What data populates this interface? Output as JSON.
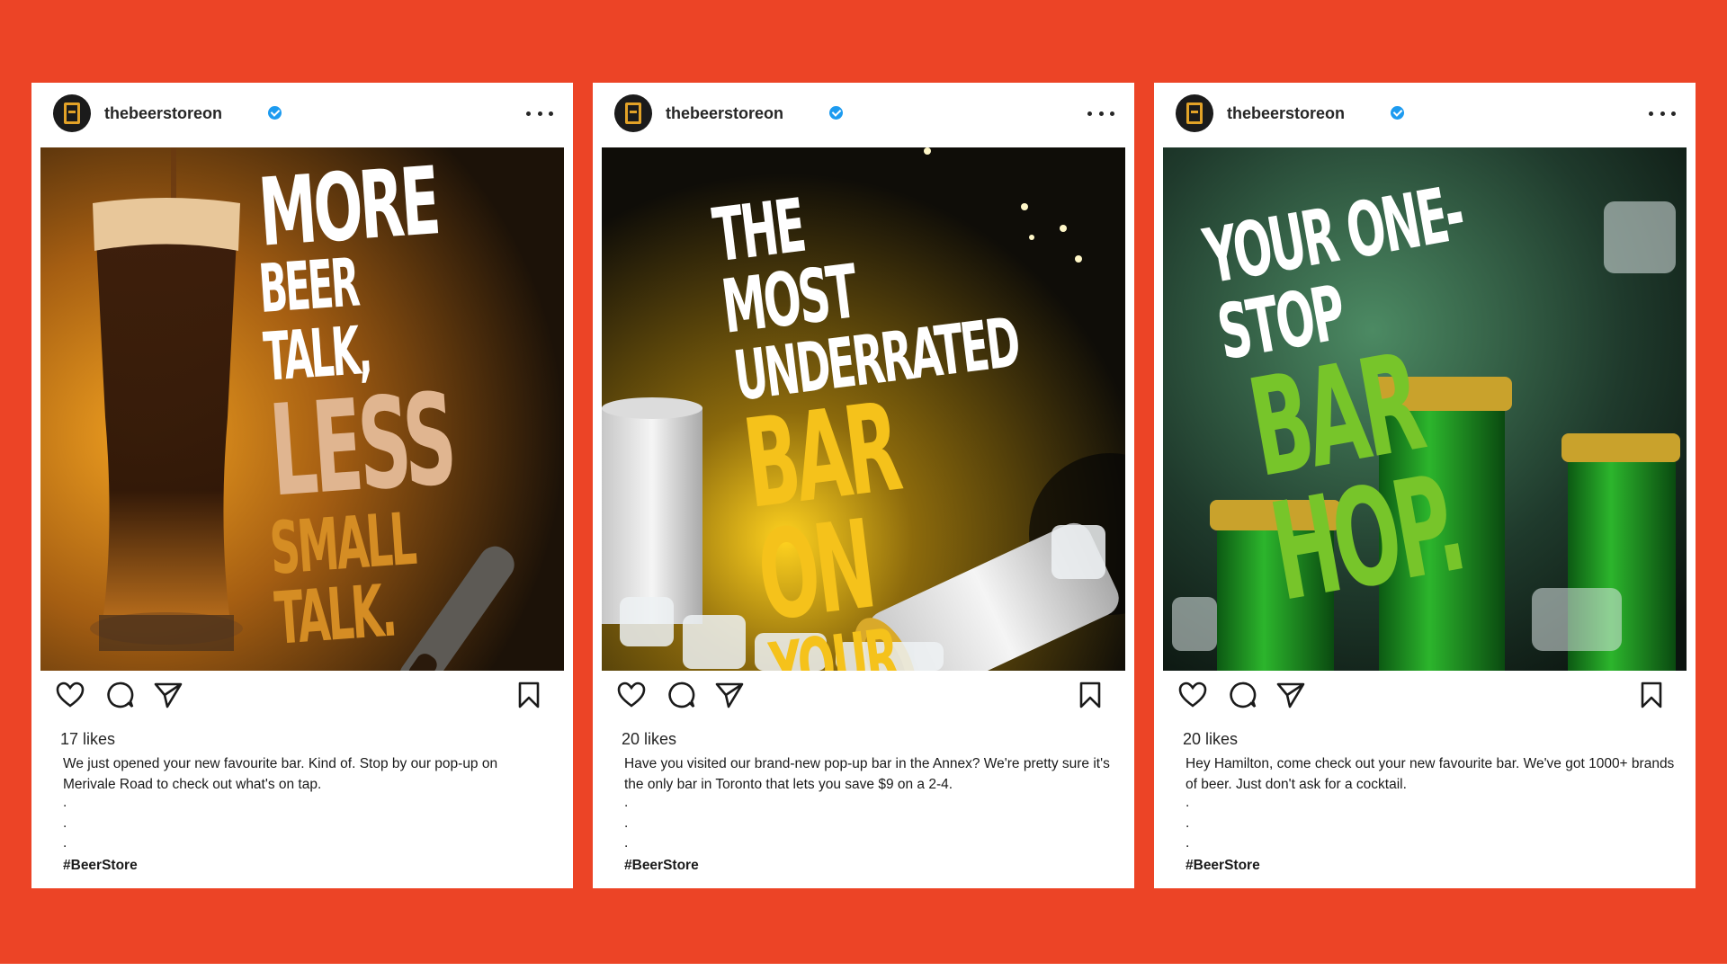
{
  "brand_color": "#ec4426",
  "posts": [
    {
      "username": "thebeerstoreon",
      "verified": true,
      "image": {
        "theme": "amber beer glass with bottle opener",
        "headline": [
          "MORE",
          "BEER TALK,",
          "LESS",
          "SMALL TALK."
        ]
      },
      "likes": "17 likes",
      "caption": "We just opened your new favourite bar. Kind of. Stop by our pop-up on Merivale Road to check out what's on tap.",
      "dots": [
        ".",
        ".",
        "."
      ],
      "hashtag": "#BeerStore"
    },
    {
      "username": "thebeerstoreon",
      "verified": true,
      "image": {
        "theme": "silver cans on ice with gold lights",
        "headline": [
          "THE MOST",
          "UNDERRATED",
          "BAR ON",
          "YOUR STREET."
        ]
      },
      "likes": "20 likes",
      "caption": "Have you visited our brand-new pop-up bar in the Annex? We're pretty sure it's the only bar in Toronto that lets you save $9 on a 2-4.",
      "dots": [
        ".",
        ".",
        "."
      ],
      "hashtag": "#BeerStore"
    },
    {
      "username": "thebeerstoreon",
      "verified": true,
      "image": {
        "theme": "green beer bottles on ice",
        "headline": [
          "YOUR ONE-STOP",
          "BAR HOP."
        ]
      },
      "likes": "20 likes",
      "caption": "Hey Hamilton, come check out your new favourite bar. We've got 1000+ brands of beer. Just don't ask for a cocktail.",
      "dots": [
        ".",
        ".",
        "."
      ],
      "hashtag": "#BeerStore"
    }
  ],
  "icons": [
    "avatar",
    "verified-badge-icon",
    "more-options-icon",
    "heart-icon",
    "comment-icon",
    "share-icon",
    "bookmark-icon"
  ]
}
